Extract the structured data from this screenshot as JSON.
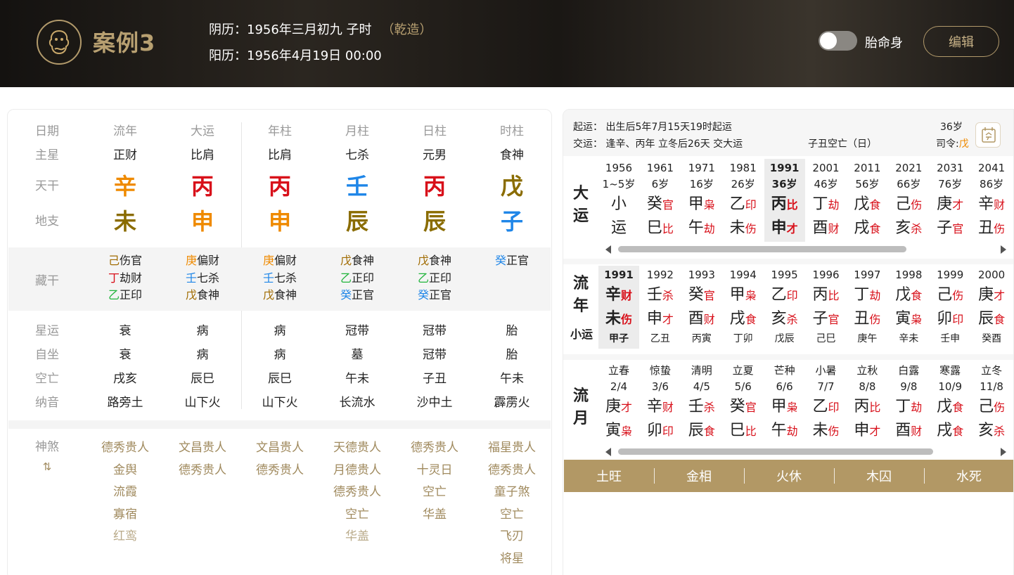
{
  "header": {
    "title": "案例3",
    "lunar": "阴历：1956年三月初九 子时",
    "lunar_tag": "（乾造）",
    "solar": "阳历：1956年4月19日 00:00",
    "toggle_label": "胎命身",
    "edit_label": "编辑"
  },
  "chart": {
    "row_labels": {
      "date": "日期",
      "main_star": "主星",
      "tiangan": "天干",
      "dizhi": "地支",
      "canggan": "藏干",
      "xingyun": "星运",
      "zizuo": "自坐",
      "kongwang": "空亡",
      "nayin": "纳音",
      "shensha": "神煞",
      "shensha_icon": "⇅"
    },
    "columns": [
      {
        "head": "流年",
        "main": "正财",
        "gan": "辛",
        "gan_color": "#ef8a00",
        "zhi": "未",
        "zhi_color": "#8a6c00",
        "cang": [
          {
            "g": "己",
            "c": "#a06b00",
            "t": "伤官"
          },
          {
            "g": "丁",
            "c": "#d8101a",
            "t": "劫财"
          },
          {
            "g": "乙",
            "c": "#21b43b",
            "t": "正印"
          }
        ],
        "xingyun": "衰",
        "zizuo": "衰",
        "kong": "戌亥",
        "nayin": "路旁土",
        "shensha": [
          {
            "t": "德秀贵人",
            "s": "gold"
          },
          {
            "t": "金舆",
            "s": "gold"
          },
          {
            "t": "流霞",
            "s": "gold"
          },
          {
            "t": "寡宿",
            "s": "gold"
          },
          {
            "t": "红鸾",
            "s": "light"
          }
        ]
      },
      {
        "head": "大运",
        "main": "比肩",
        "gan": "丙",
        "gan_color": "#d8101a",
        "zhi": "申",
        "zhi_color": "#ef8a00",
        "cang": [
          {
            "g": "庚",
            "c": "#ef8a00",
            "t": "偏财"
          },
          {
            "g": "壬",
            "c": "#1f86e8",
            "t": "七杀"
          },
          {
            "g": "戊",
            "c": "#a06b00",
            "t": "食神"
          }
        ],
        "xingyun": "病",
        "zizuo": "病",
        "kong": "辰巳",
        "nayin": "山下火",
        "shensha": [
          {
            "t": "文昌贵人",
            "s": "gold"
          },
          {
            "t": "德秀贵人",
            "s": "gold"
          }
        ]
      },
      {
        "head": "年柱",
        "main": "比肩",
        "gan": "丙",
        "gan_color": "#d8101a",
        "zhi": "申",
        "zhi_color": "#ef8a00",
        "cang": [
          {
            "g": "庚",
            "c": "#ef8a00",
            "t": "偏财"
          },
          {
            "g": "壬",
            "c": "#1f86e8",
            "t": "七杀"
          },
          {
            "g": "戊",
            "c": "#a06b00",
            "t": "食神"
          }
        ],
        "xingyun": "病",
        "zizuo": "病",
        "kong": "辰巳",
        "nayin": "山下火",
        "shensha": [
          {
            "t": "文昌贵人",
            "s": "gold"
          },
          {
            "t": "德秀贵人",
            "s": "gold"
          }
        ]
      },
      {
        "head": "月柱",
        "main": "七杀",
        "gan": "壬",
        "gan_color": "#1f86e8",
        "zhi": "辰",
        "zhi_color": "#8a6c00",
        "cang": [
          {
            "g": "戊",
            "c": "#a06b00",
            "t": "食神"
          },
          {
            "g": "乙",
            "c": "#21b43b",
            "t": "正印"
          },
          {
            "g": "癸",
            "c": "#1f86e8",
            "t": "正官"
          }
        ],
        "xingyun": "冠带",
        "zizuo": "墓",
        "kong": "午未",
        "nayin": "长流水",
        "shensha": [
          {
            "t": "天德贵人",
            "s": "gold"
          },
          {
            "t": "月德贵人",
            "s": "gold"
          },
          {
            "t": "德秀贵人",
            "s": "gold"
          },
          {
            "t": "空亡",
            "s": "gold"
          },
          {
            "t": "华盖",
            "s": "light"
          }
        ]
      },
      {
        "head": "日柱",
        "main": "元男",
        "gan": "丙",
        "gan_color": "#d8101a",
        "zhi": "辰",
        "zhi_color": "#8a6c00",
        "cang": [
          {
            "g": "戊",
            "c": "#a06b00",
            "t": "食神"
          },
          {
            "g": "乙",
            "c": "#21b43b",
            "t": "正印"
          },
          {
            "g": "癸",
            "c": "#1f86e8",
            "t": "正官"
          }
        ],
        "xingyun": "冠带",
        "zizuo": "冠带",
        "kong": "子丑",
        "nayin": "沙中土",
        "shensha": [
          {
            "t": "德秀贵人",
            "s": "gold"
          },
          {
            "t": "十灵日",
            "s": "gold"
          },
          {
            "t": "空亡",
            "s": "gold"
          },
          {
            "t": "华盖",
            "s": "gold"
          }
        ]
      },
      {
        "head": "时柱",
        "main": "食神",
        "gan": "戊",
        "gan_color": "#8a6c00",
        "zhi": "子",
        "zhi_color": "#1f86e8",
        "cang": [
          {
            "g": "癸",
            "c": "#1f86e8",
            "t": "正官"
          }
        ],
        "xingyun": "胎",
        "zizuo": "胎",
        "kong": "午未",
        "nayin": "霹雳火",
        "shensha": [
          {
            "t": "福星贵人",
            "s": "gold"
          },
          {
            "t": "德秀贵人",
            "s": "gold"
          },
          {
            "t": "童子煞",
            "s": "gold"
          },
          {
            "t": "空亡",
            "s": "gold"
          },
          {
            "t": "飞刃",
            "s": "gold"
          },
          {
            "t": "将星",
            "s": "gold"
          }
        ]
      }
    ]
  },
  "info": {
    "qiyun": "起运： 出生后5年7月15天19时起运",
    "jiaoyun": "交运： 逢辛、丙年 立冬后26天 交大运",
    "kongwang": "子丑空亡（日）",
    "age": "36岁",
    "siling_label": "司令:",
    "siling_value": "戊"
  },
  "dayun": {
    "title": [
      "大",
      "运"
    ],
    "items": [
      {
        "y": "1956",
        "a": "1~5岁",
        "g": "小",
        "gs": "",
        "z": "运",
        "zs": "",
        "sel": false
      },
      {
        "y": "1961",
        "a": "6岁",
        "g": "癸",
        "gs": "官",
        "z": "巳",
        "zs": "比",
        "sel": false
      },
      {
        "y": "1971",
        "a": "16岁",
        "g": "甲",
        "gs": "枭",
        "z": "午",
        "zs": "劫",
        "sel": false
      },
      {
        "y": "1981",
        "a": "26岁",
        "g": "乙",
        "gs": "印",
        "z": "未",
        "zs": "伤",
        "sel": false
      },
      {
        "y": "1991",
        "a": "36岁",
        "g": "丙",
        "gs": "比",
        "z": "申",
        "zs": "才",
        "sel": true
      },
      {
        "y": "2001",
        "a": "46岁",
        "g": "丁",
        "gs": "劫",
        "z": "酉",
        "zs": "财",
        "sel": false
      },
      {
        "y": "2011",
        "a": "56岁",
        "g": "戊",
        "gs": "食",
        "z": "戌",
        "zs": "食",
        "sel": false
      },
      {
        "y": "2021",
        "a": "66岁",
        "g": "己",
        "gs": "伤",
        "z": "亥",
        "zs": "杀",
        "sel": false
      },
      {
        "y": "2031",
        "a": "76岁",
        "g": "庚",
        "gs": "才",
        "z": "子",
        "zs": "官",
        "sel": false
      },
      {
        "y": "2041",
        "a": "86岁",
        "g": "辛",
        "gs": "财",
        "z": "丑",
        "zs": "伤",
        "sel": false
      }
    ]
  },
  "liunian": {
    "title": [
      "流",
      "年"
    ],
    "sub": "小运",
    "items": [
      {
        "y": "1991",
        "g": "辛",
        "gs": "财",
        "z": "未",
        "zs": "伤",
        "x": "甲子",
        "sel": true
      },
      {
        "y": "1992",
        "g": "壬",
        "gs": "杀",
        "z": "申",
        "zs": "才",
        "x": "乙丑",
        "sel": false
      },
      {
        "y": "1993",
        "g": "癸",
        "gs": "官",
        "z": "酉",
        "zs": "财",
        "x": "丙寅",
        "sel": false
      },
      {
        "y": "1994",
        "g": "甲",
        "gs": "枭",
        "z": "戌",
        "zs": "食",
        "x": "丁卯",
        "sel": false
      },
      {
        "y": "1995",
        "g": "乙",
        "gs": "印",
        "z": "亥",
        "zs": "杀",
        "x": "戊辰",
        "sel": false
      },
      {
        "y": "1996",
        "g": "丙",
        "gs": "比",
        "z": "子",
        "zs": "官",
        "x": "己巳",
        "sel": false
      },
      {
        "y": "1997",
        "g": "丁",
        "gs": "劫",
        "z": "丑",
        "zs": "伤",
        "x": "庚午",
        "sel": false
      },
      {
        "y": "1998",
        "g": "戊",
        "gs": "食",
        "z": "寅",
        "zs": "枭",
        "x": "辛未",
        "sel": false
      },
      {
        "y": "1999",
        "g": "己",
        "gs": "伤",
        "z": "卯",
        "zs": "印",
        "x": "壬申",
        "sel": false
      },
      {
        "y": "2000",
        "g": "庚",
        "gs": "才",
        "z": "辰",
        "zs": "食",
        "x": "癸酉",
        "sel": false
      }
    ]
  },
  "liuyue": {
    "title": [
      "流",
      "月"
    ],
    "items": [
      {
        "y": "立春",
        "d": "2/4",
        "g": "庚",
        "gs": "才",
        "z": "寅",
        "zs": "枭"
      },
      {
        "y": "惊蛰",
        "d": "3/6",
        "g": "辛",
        "gs": "财",
        "z": "卯",
        "zs": "印"
      },
      {
        "y": "清明",
        "d": "4/5",
        "g": "壬",
        "gs": "杀",
        "z": "辰",
        "zs": "食"
      },
      {
        "y": "立夏",
        "d": "5/6",
        "g": "癸",
        "gs": "官",
        "z": "巳",
        "zs": "比"
      },
      {
        "y": "芒种",
        "d": "6/6",
        "g": "甲",
        "gs": "枭",
        "z": "午",
        "zs": "劫"
      },
      {
        "y": "小暑",
        "d": "7/7",
        "g": "乙",
        "gs": "印",
        "z": "未",
        "zs": "伤"
      },
      {
        "y": "立秋",
        "d": "8/8",
        "g": "丙",
        "gs": "比",
        "z": "申",
        "zs": "才"
      },
      {
        "y": "白露",
        "d": "9/8",
        "g": "丁",
        "gs": "劫",
        "z": "酉",
        "zs": "财"
      },
      {
        "y": "寒露",
        "d": "10/9",
        "g": "戊",
        "gs": "食",
        "z": "戌",
        "zs": "食"
      },
      {
        "y": "立冬",
        "d": "11/8",
        "g": "己",
        "gs": "伤",
        "z": "亥",
        "zs": "杀"
      }
    ]
  },
  "wuxing": [
    "土旺",
    "金相",
    "火休",
    "木囚",
    "水死"
  ]
}
